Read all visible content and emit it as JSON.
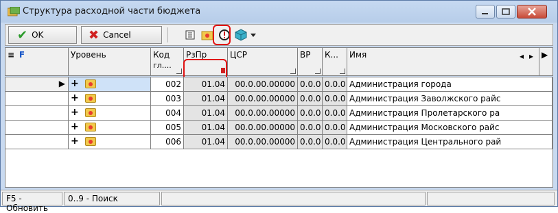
{
  "window": {
    "title": "Структура расходной части бюджета",
    "icons": [
      "app-icon",
      "minimize-icon",
      "maximize-icon",
      "close-icon"
    ]
  },
  "toolbar": {
    "ok_label": "OK",
    "cancel_label": "Cancel",
    "icons": [
      "book-icon",
      "folder-icon",
      "alert-icon",
      "cube-icon",
      "dropdown-arrow-icon"
    ]
  },
  "grid": {
    "header_icons": [
      "filter-list-icon",
      "filter-f-icon"
    ],
    "columns": [
      {
        "label": "Уровень"
      },
      {
        "label": "Код",
        "sub": "гл...."
      },
      {
        "label": "РзПр"
      },
      {
        "label": "ЦСР"
      },
      {
        "label": "ВР"
      },
      {
        "label": "К..."
      },
      {
        "label": "Имя"
      }
    ],
    "rows": [
      {
        "kod": "002",
        "rzpr": "01.04",
        "csr": "00.0.00.00000",
        "vr": "0.0.0",
        "k": "0.0.0",
        "name": "Администрация города"
      },
      {
        "kod": "003",
        "rzpr": "01.04",
        "csr": "00.0.00.00000",
        "vr": "0.0.0",
        "k": "0.0.0",
        "name": "Администрация Заволжского райс"
      },
      {
        "kod": "004",
        "rzpr": "01.04",
        "csr": "00.0.00.00000",
        "vr": "0.0.0",
        "k": "0.0.0",
        "name": "Администрация Пролетарского ра"
      },
      {
        "kod": "005",
        "rzpr": "01.04",
        "csr": "00.0.00.00000",
        "vr": "0.0.0",
        "k": "0.0.0",
        "name": "Администрация Московского райс"
      },
      {
        "kod": "006",
        "rzpr": "01.04",
        "csr": "00.0.00.00000",
        "vr": "0.0.0",
        "k": "0.0.0",
        "name": "Администрация Центрального рай"
      }
    ]
  },
  "status": {
    "refresh": "F5 - Обновить",
    "search": "0..9 - Поиск"
  }
}
